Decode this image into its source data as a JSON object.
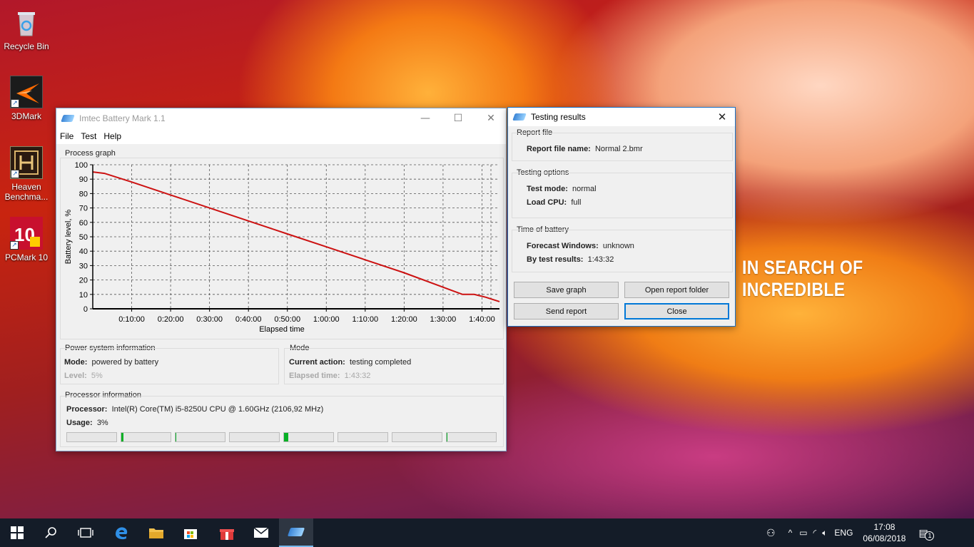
{
  "desktop": {
    "icons": [
      {
        "label": "Recycle Bin"
      },
      {
        "label": "3DMark"
      },
      {
        "label": "Heaven Benchma..."
      },
      {
        "label": "PCMark 10"
      }
    ],
    "banner": "IN SEARCH OF INCREDIBLE"
  },
  "main_window": {
    "title": "Imtec Battery Mark 1.1",
    "menu": [
      "File",
      "Test",
      "Help"
    ],
    "graph_group": "Process graph",
    "power_group": "Power system information",
    "mode_label": "Mode:",
    "mode_value": "powered by battery",
    "level_label": "Level:",
    "level_value": "5%",
    "mode_group": "Mode",
    "current_action_label": "Current action:",
    "current_action_value": "testing completed",
    "elapsed_label": "Elapsed time:",
    "elapsed_value": "1:43:32",
    "processor_group": "Processor information",
    "processor_label": "Processor:",
    "processor_value": "Intel(R) Core(TM) i5-8250U CPU @ 1.60GHz  (2106,92 MHz)",
    "usage_label": "Usage:",
    "usage_value": "3%",
    "core_usage": [
      0,
      0.05,
      0.02,
      0,
      0.08,
      0,
      0,
      0.02
    ]
  },
  "chart_data": {
    "type": "line",
    "title": "",
    "xlabel": "Elapsed time",
    "ylabel": "Battery level, %",
    "xlim": [
      0,
      104.5
    ],
    "ylim": [
      0,
      100
    ],
    "x_ticks": [
      "0:10:00",
      "0:20:00",
      "0:30:00",
      "0:40:00",
      "0:50:00",
      "1:00:00",
      "1:10:00",
      "1:20:00",
      "1:30:00",
      "1:40:00"
    ],
    "y_ticks": [
      "0",
      "10",
      "20",
      "30",
      "40",
      "50",
      "60",
      "70",
      "80",
      "90",
      "100"
    ],
    "grid": true,
    "series": [
      {
        "x": [
          0,
          3,
          10,
          20,
          30,
          40,
          50,
          60,
          70,
          80,
          90,
          95,
          98,
          101,
          104.5
        ],
        "y": [
          95,
          94,
          88,
          79,
          70,
          61,
          52,
          43,
          34,
          25,
          15,
          10,
          10,
          8,
          5
        ],
        "color": "#cc1111"
      }
    ]
  },
  "results_window": {
    "title": "Testing results",
    "report_group": "Report file",
    "report_name_label": "Report file name:",
    "report_name_value": "Normal 2.bmr",
    "options_group": "Testing options",
    "test_mode_label": "Test mode:",
    "test_mode_value": "normal",
    "load_cpu_label": "Load CPU:",
    "load_cpu_value": "full",
    "time_group": "Time of battery",
    "forecast_label": "Forecast Windows:",
    "forecast_value": "unknown",
    "by_test_label": "By test results:",
    "by_test_value": "1:43:32",
    "buttons": {
      "save_graph": "Save graph",
      "open_folder": "Open report folder",
      "send_report": "Send report",
      "close": "Close"
    }
  },
  "taskbar": {
    "language": "ENG",
    "time": "17:08",
    "date": "06/08/2018",
    "notification_count": "1"
  }
}
